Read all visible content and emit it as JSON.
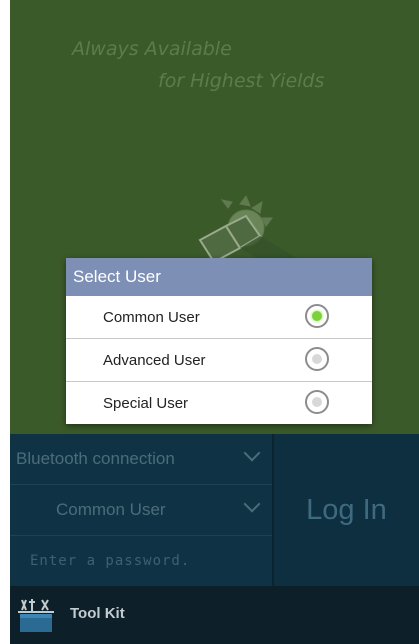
{
  "hero": {
    "tagline_line1": "Always Available",
    "tagline_line2": "for Highest Yields",
    "logo_icon": "sun-solar-panel-logo"
  },
  "dialog": {
    "title": "Select User",
    "options": [
      {
        "label": "Common User",
        "selected": true
      },
      {
        "label": "Advanced User",
        "selected": false
      },
      {
        "label": "Special User",
        "selected": false
      }
    ]
  },
  "login": {
    "connection_label": "Bluetooth connection",
    "user_label": "Common User",
    "password_placeholder": "Enter a password.",
    "login_button": "Log In"
  },
  "toolbar": {
    "label": "Tool Kit",
    "icon": "toolbox-icon"
  },
  "colors": {
    "hero_green": "#3b5a2a",
    "dialog_title_bg": "#7d8fb5",
    "panel_bg": "#0f3344",
    "radio_selected": "#7bd23b"
  }
}
